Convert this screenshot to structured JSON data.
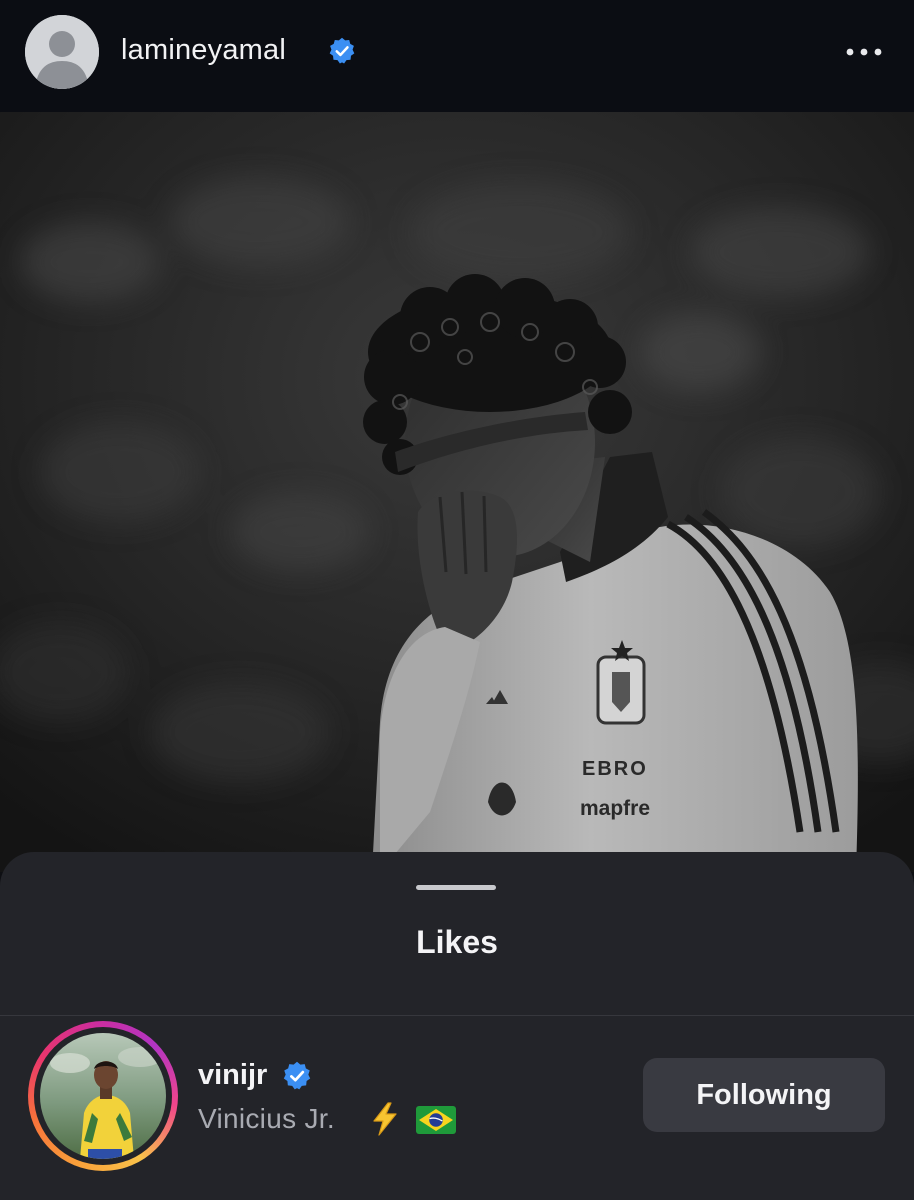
{
  "post": {
    "username": "lamineyamal",
    "verified": true,
    "more_icon": "more-horizontal-icon",
    "photo_icon": "post-photo"
  },
  "likes_sheet": {
    "title": "Likes",
    "users": [
      {
        "username": "vinijr",
        "verified": true,
        "full_name": "Vinicius Jr.",
        "emoji": [
          "high-voltage-emoji",
          "brazil-flag-emoji"
        ],
        "button_label": "Following",
        "has_story_ring": true
      }
    ]
  },
  "colors": {
    "header_bg": "#0b0d13",
    "sheet_bg": "#232429",
    "button_bg": "#393a41",
    "verified_blue": "#3b8ff3",
    "secondary_text": "#a9abb2"
  }
}
